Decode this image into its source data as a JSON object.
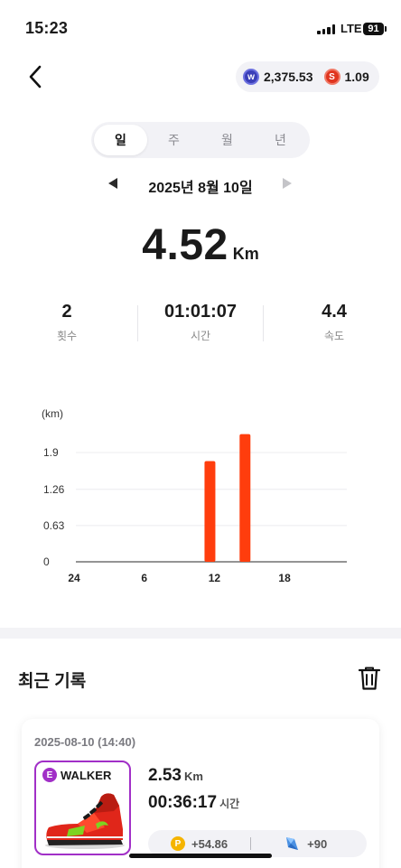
{
  "status_bar": {
    "time": "15:23",
    "network": "LTE",
    "battery": "91"
  },
  "wallet": {
    "token1_amount": "2,375.53",
    "token2_amount": "1.09",
    "token1_icon": "walker-token-icon",
    "token2_icon": "s-token-icon"
  },
  "period_tabs": [
    {
      "label": "일",
      "active": true
    },
    {
      "label": "주",
      "active": false
    },
    {
      "label": "월",
      "active": false
    },
    {
      "label": "년",
      "active": false
    }
  ],
  "date": "2025년 8월 10일",
  "summary": {
    "distance": "4.52",
    "distance_unit": "Km"
  },
  "stats": [
    {
      "value": "2",
      "label": "횟수"
    },
    {
      "value": "01:01:07",
      "label": "시간"
    },
    {
      "value": "4.4",
      "label": "속도"
    }
  ],
  "chart_data": {
    "type": "bar",
    "ylabel": "(km)",
    "ylim": [
      0,
      2.5
    ],
    "yticks": [
      "0",
      "0.63",
      "1.26",
      "1.9"
    ],
    "yticks_values": [
      0,
      0.63,
      1.26,
      1.9
    ],
    "xticks": [
      "24",
      "6",
      "12",
      "18"
    ],
    "xticks_values": [
      0,
      6,
      12,
      18
    ],
    "x_range": [
      0,
      24
    ],
    "bars": [
      {
        "hour": 11,
        "value": 1.75
      },
      {
        "hour": 14,
        "value": 2.22
      }
    ],
    "color": "#ff3d0d",
    "grid": true
  },
  "recent": {
    "title": "최근 기록",
    "record": {
      "datetime": "2025-08-10 (14:40)",
      "badge_letter": "E",
      "shoe_name": "WALKER",
      "distance": "2.53",
      "distance_unit": "Km",
      "time": "00:36:17",
      "time_unit": "시간",
      "reward_points": "+54.86",
      "reward_gems": "+90"
    }
  },
  "colors": {
    "accent": "#ff3d0d",
    "shoe_border": "#a12fc7"
  }
}
